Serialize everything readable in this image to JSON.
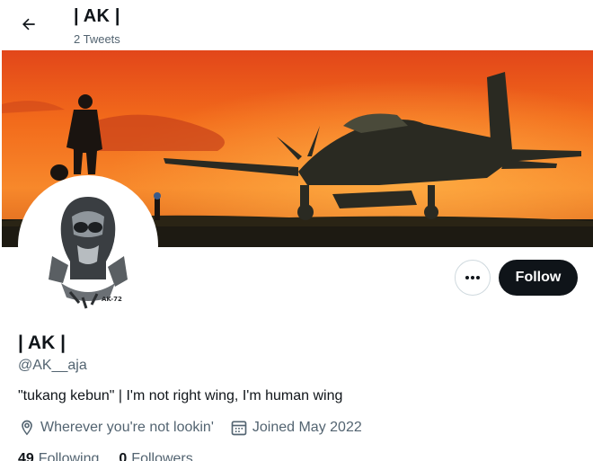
{
  "header": {
    "title": "| AK |",
    "tweet_count": "2 Tweets"
  },
  "profile": {
    "display_name": "| AK |",
    "handle": "@AK__aja",
    "bio": "\"tukang kebun\" | I'm not right wing, I'm human wing",
    "location": "Wherever you're not lookin'",
    "joined": "Joined May 2022",
    "avatar_text": "AK-72"
  },
  "actions": {
    "follow_label": "Follow"
  },
  "stats": {
    "following_count": "49",
    "following_label": "Following",
    "followers_count": "0",
    "followers_label": "Followers"
  },
  "icons": {
    "back": "arrow-left-icon",
    "more": "more-dots-icon",
    "location": "location-pin-icon",
    "calendar": "calendar-icon"
  },
  "colors": {
    "text": "#0f1419",
    "muted": "#536471",
    "follow_bg": "#0f1419",
    "sunset_orange": "#f26a1b"
  }
}
